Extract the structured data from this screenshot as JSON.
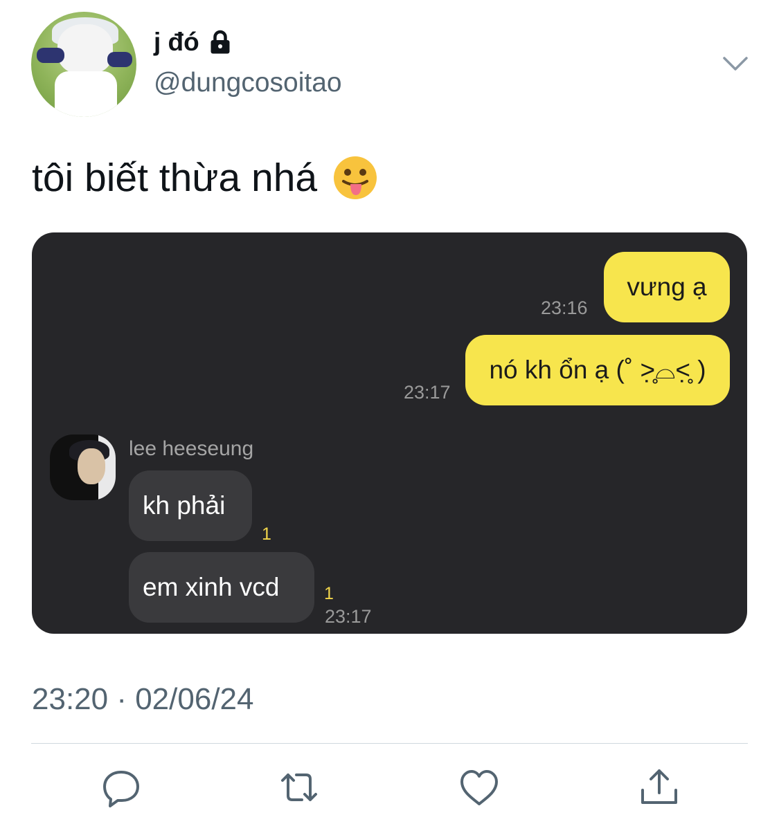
{
  "author": {
    "display_name": "j đó",
    "handle": "@dungcosoitao",
    "locked_icon": "lock-icon"
  },
  "tweet": {
    "text": "tôi biết thừa nhá",
    "emoji": "😛",
    "timestamp": "23:20 · 02/06/24"
  },
  "chat": {
    "messages_sent": [
      {
        "text": "vưng ạ",
        "time": "23:16"
      },
      {
        "text": "nó kh ổn ạ (˚ ˃̣̣̥⌓˂̣̣̥ )",
        "time": "23:17"
      }
    ],
    "sender_name": "lee heeseung",
    "messages_received": [
      {
        "text": "kh phải",
        "unread": "1"
      },
      {
        "text": "em xinh vcd",
        "unread": "1",
        "time": "23:17"
      }
    ],
    "colors": {
      "background": "#262629",
      "sent_bubble": "#f7e54d",
      "received_bubble": "#3a3a3d"
    }
  },
  "actions": [
    "reply-icon",
    "retweet-icon",
    "like-icon",
    "share-icon"
  ]
}
